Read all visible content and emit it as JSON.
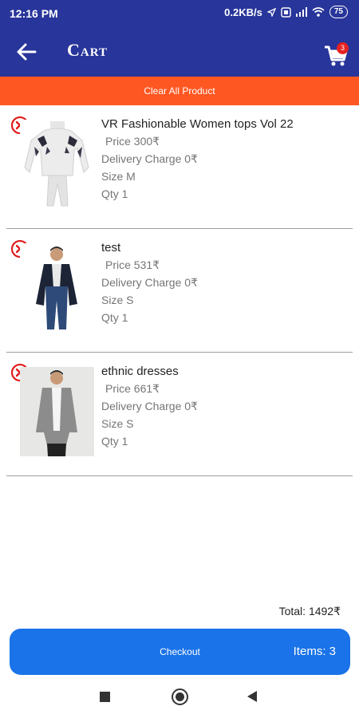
{
  "status_bar": {
    "time": "12:16 PM",
    "network_speed": "0.2KB/s",
    "battery": "75"
  },
  "header": {
    "title": "Cart",
    "cart_badge": "3",
    "color": "#28359a"
  },
  "clear_all": {
    "label": "Clear All Product",
    "color": "#ff5722"
  },
  "items": [
    {
      "name": "VR Fashionable Women tops Vol 22",
      "price": "Price 300₹",
      "delivery": "Delivery Charge 0₹",
      "size": "Size M",
      "qty": "Qty 1"
    },
    {
      "name": "test",
      "price": "Price 531₹",
      "delivery": "Delivery Charge 0₹",
      "size": "Size S",
      "qty": "Qty 1"
    },
    {
      "name": "ethnic dresses",
      "price": "Price 661₹",
      "delivery": "Delivery Charge 0₹",
      "size": "Size S",
      "qty": "Qty 1"
    }
  ],
  "summary": {
    "total": "Total: 1492₹"
  },
  "checkout": {
    "label": "Checkout",
    "items": "Items: 3",
    "color": "#1a73e8"
  }
}
